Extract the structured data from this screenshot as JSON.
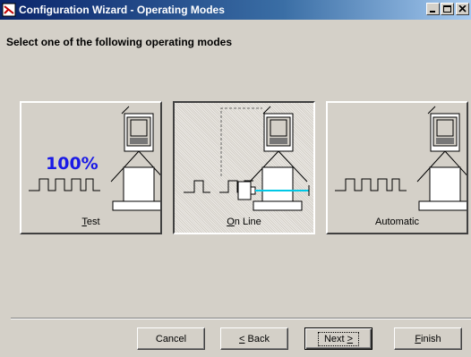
{
  "window": {
    "title": "Configuration Wizard - Operating Modes",
    "controls": [
      "minimize",
      "maximize",
      "close"
    ]
  },
  "instruction": "Select one of the following operating modes",
  "modes": [
    {
      "mnemonic": "T",
      "rest": "est",
      "selected": false,
      "display": "100%"
    },
    {
      "mnemonic": "O",
      "rest": "n Line",
      "selected": true
    },
    {
      "mnemonic": "",
      "rest": "Automatic",
      "selected": false
    }
  ],
  "buttons": {
    "cancel": "Cancel",
    "back_mnemonic": "<",
    "back_rest": " Back",
    "next_text": "Next ",
    "next_mnemonic": ">",
    "finish_mnemonic": "F",
    "finish_rest": "inish"
  },
  "colors": {
    "title_start": "#0a246a",
    "title_end": "#a6caf0",
    "face": "#d4d0c8",
    "percent_text": "#1a1ae6",
    "beam": "#00c8e6"
  }
}
